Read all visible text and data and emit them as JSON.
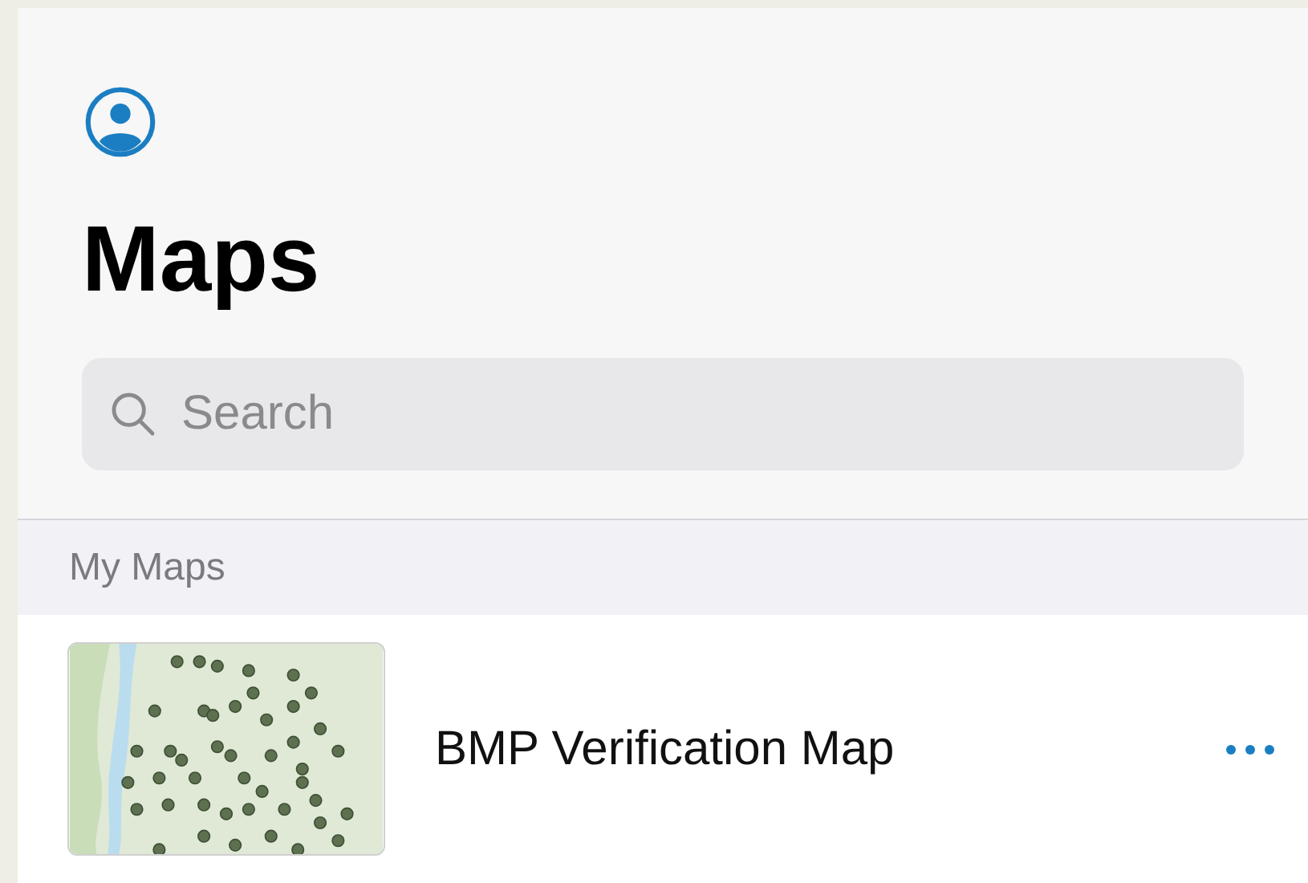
{
  "title": "Maps",
  "search": {
    "placeholder": "Search"
  },
  "sections": [
    {
      "header": "My Maps",
      "items": [
        {
          "title": "BMP Verification Map"
        }
      ]
    }
  ]
}
